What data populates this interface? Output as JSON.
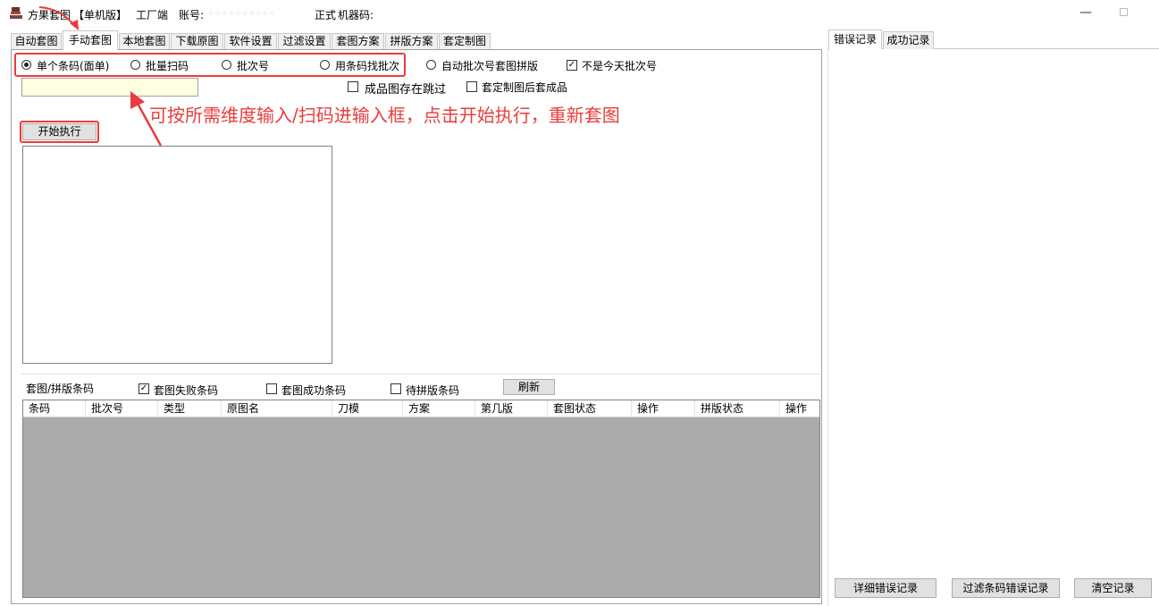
{
  "window": {
    "app_name": "方果套图",
    "edition": "【单机版】",
    "client_type": "工厂端",
    "account_label": "账号:",
    "account_value": "· · · · · · · · · ·",
    "license_type": "正式",
    "machine_code_label": "机器码:",
    "min_glyph": "—"
  },
  "tabs": [
    {
      "label": "自动套图"
    },
    {
      "label": "手动套图",
      "active": true
    },
    {
      "label": "本地套图"
    },
    {
      "label": "下载原图"
    },
    {
      "label": "软件设置"
    },
    {
      "label": "过滤设置"
    },
    {
      "label": "套图方案"
    },
    {
      "label": "拼版方案"
    },
    {
      "label": "套定制图"
    }
  ],
  "modes": {
    "single": {
      "label": "单个条码(面单)",
      "selected": true
    },
    "batch_scan": {
      "label": "批量扫码",
      "selected": false
    },
    "batch_no": {
      "label": "批次号",
      "selected": false
    },
    "find_batch": {
      "label": "用条码找批次",
      "selected": false
    },
    "auto_batch": {
      "label": "自动批次号套图拼版",
      "selected": false
    }
  },
  "options": {
    "not_today": {
      "label": "不是今天批次号",
      "checked": true
    },
    "skip_existing": {
      "label": "成品图存在跳过",
      "checked": false
    },
    "custom_after": {
      "label": "套定制图后套成品",
      "checked": false
    }
  },
  "barcode_input": {
    "value": "",
    "placeholder": ""
  },
  "start_button": {
    "label": "开始执行"
  },
  "annotation": {
    "text": "可按所需维度输入/扫码进输入框，点击开始执行，重新套图",
    "color": "#ea3c3c"
  },
  "filter_bar": {
    "title": "套图/拼版条码",
    "failed": {
      "label": "套图失败条码",
      "checked": true
    },
    "success": {
      "label": "套图成功条码",
      "checked": false
    },
    "pending": {
      "label": "待拼版条码",
      "checked": false
    },
    "refresh_label": "刷新"
  },
  "grid": {
    "columns": [
      "条码",
      "批次号",
      "类型",
      "原图名",
      "刀模",
      "方案",
      "第几版",
      "套图状态",
      "操作",
      "拼版状态",
      "操作"
    ],
    "rows": [],
    "empty_color": "#ababab"
  },
  "right_panel": {
    "tabs": [
      {
        "label": "错误记录",
        "active": true
      },
      {
        "label": "成功记录"
      }
    ],
    "buttons": {
      "detail": "详细错误记录",
      "filter": "过滤条码错误记录",
      "clear": "清空记录"
    }
  },
  "colors": {
    "highlight_red": "#ea3c3c",
    "input_bg": "#ffffe1",
    "grid_empty": "#ababab"
  }
}
